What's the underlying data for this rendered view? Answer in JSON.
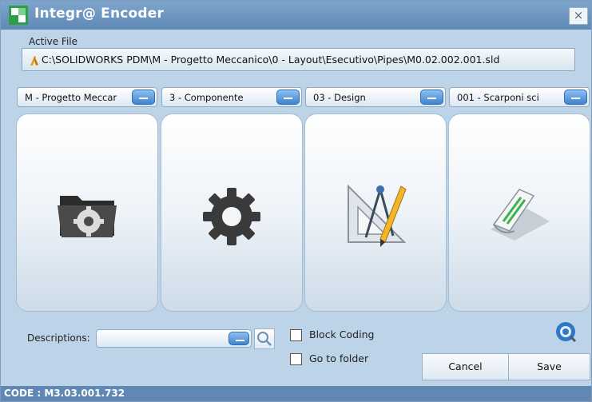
{
  "window": {
    "title": "Integr@ Encoder",
    "close_symbol": "×"
  },
  "active_file": {
    "label": "Active File",
    "path": "C:\\SOLIDWORKS PDM\\M - Progetto Meccanico\\0 - Layout\\Esecutivo\\Pipes\\M0.02.002.001.sld"
  },
  "selectors": [
    {
      "value": "M - Progetto Meccar",
      "icon": "folder-gear-icon"
    },
    {
      "value": "3 - Componente",
      "icon": "gear-icon"
    },
    {
      "value": "03 - Design",
      "icon": "drafting-tools-icon"
    },
    {
      "value": "001 - Scarponi sci",
      "icon": "sheet-icon"
    }
  ],
  "descriptions": {
    "label": "Descriptions:",
    "value": ""
  },
  "options": {
    "block_coding": {
      "label": "Block Coding",
      "checked": false
    },
    "go_to_folder": {
      "label": "Go to folder",
      "checked": false
    }
  },
  "buttons": {
    "cancel": "Cancel",
    "save": "Save"
  },
  "status": {
    "code": "CODE : M3.03.001.732"
  },
  "colors": {
    "title_bar": "#6f98c3",
    "background": "#bcd3e8",
    "accent": "#3e84cf"
  }
}
